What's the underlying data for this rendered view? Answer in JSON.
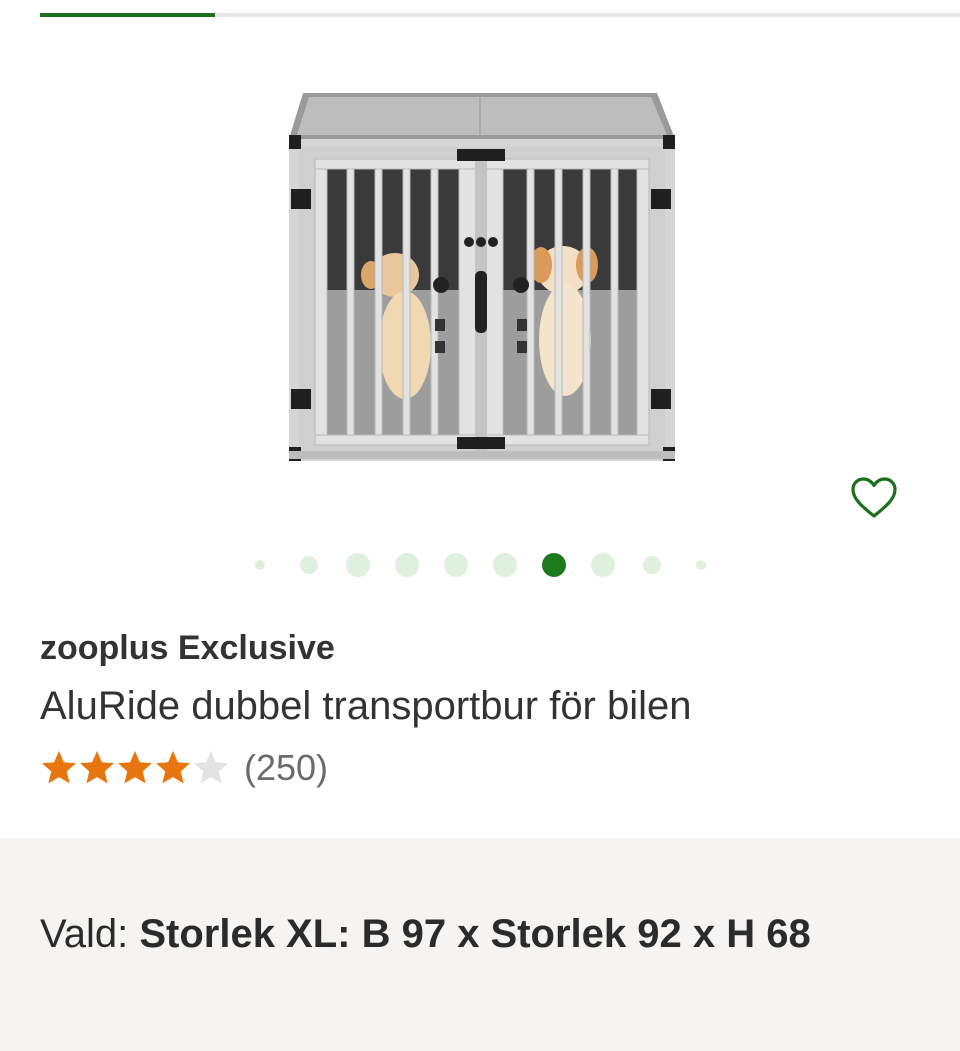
{
  "progress": {
    "fraction": 0.19,
    "fill_color": "#1d6f1d",
    "track_color": "#e6e6e6"
  },
  "gallery": {
    "image_alt_icon": "dog-crate-image",
    "dots": [
      {
        "state": "far"
      },
      {
        "state": "near"
      },
      {
        "state": "normal"
      },
      {
        "state": "normal"
      },
      {
        "state": "normal"
      },
      {
        "state": "normal"
      },
      {
        "state": "active"
      },
      {
        "state": "normal"
      },
      {
        "state": "near"
      },
      {
        "state": "far"
      }
    ],
    "active_index": 6,
    "active_color": "#1d7a1d",
    "inactive_color": "#dff0df"
  },
  "wishlist": {
    "icon": "heart-outline-icon",
    "color": "#1d6f1d"
  },
  "product": {
    "brand": "zooplus Exclusive",
    "name": "AluRide dubbel transportbur för bilen"
  },
  "rating": {
    "stars": 4,
    "max_stars": 5,
    "review_count": "(250)",
    "star_color": "#e8760f",
    "empty_star_color": "#e3e3e3"
  },
  "variant": {
    "label": "Vald: ",
    "value": "Storlek XL: B 97 x Storlek 92 x H 68"
  }
}
